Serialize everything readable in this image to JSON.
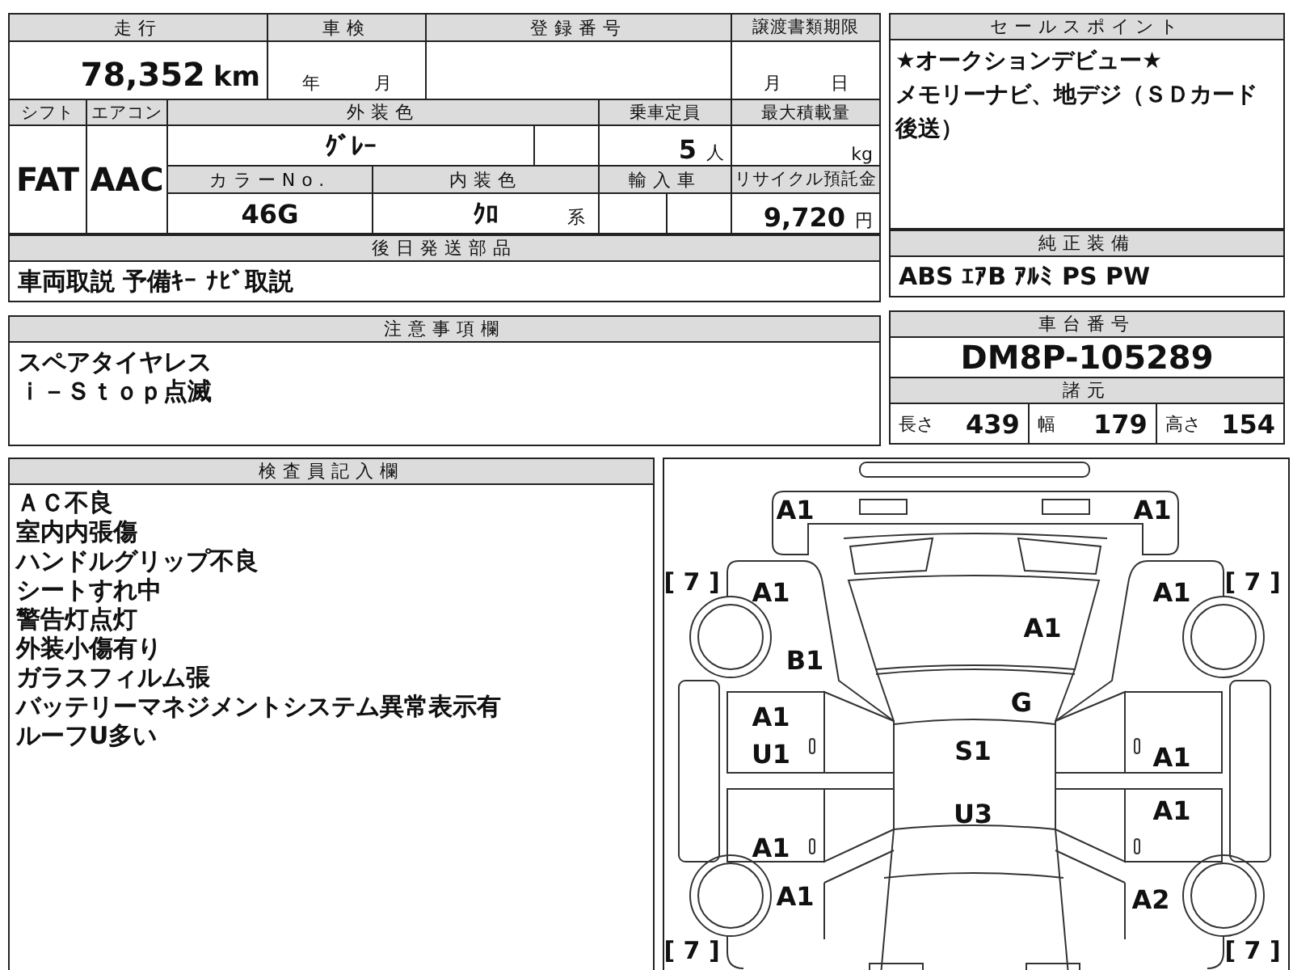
{
  "vehicle_table": {
    "mileage": {
      "label": "走行",
      "value": "78,352",
      "unit": "km"
    },
    "inspection": {
      "label": "車検",
      "year_unit": "年",
      "month_unit": "月"
    },
    "registration_number": {
      "label": "登録番号"
    },
    "document_deadline": {
      "label": "譲渡書類期限",
      "month_unit": "月",
      "day_unit": "日"
    },
    "shift": {
      "label": "シフト",
      "value": "FAT"
    },
    "aircon": {
      "label": "エアコン",
      "value": "AAC"
    },
    "exterior_color": {
      "label": "外装色",
      "value": "ｸﾞﾚｰ"
    },
    "capacity": {
      "label": "乗車定員",
      "value": "5",
      "unit": "人"
    },
    "max_load": {
      "label": "最大積載量",
      "unit": "kg"
    },
    "color_no": {
      "label": "カラーNo.",
      "value": "46G"
    },
    "interior_color": {
      "label": "内装色",
      "value": "ｸﾛ",
      "suffix": "系"
    },
    "import_car": {
      "label": "輸入車"
    },
    "recycle_fee": {
      "label": "リサイクル預託金",
      "value": "9,720",
      "unit": "円"
    }
  },
  "later_parts": {
    "label": "後日発送部品",
    "value": "車両取説 予備ｷｰ ﾅﾋﾞ取説"
  },
  "caution": {
    "label": "注意事項欄",
    "lines": [
      "スペアタイヤレス",
      "ｉ－Ｓｔｏｐ点滅"
    ]
  },
  "sales_points": {
    "label": "セールスポイント",
    "lines": [
      "★オークションデビュー★",
      "メモリーナビ、地デジ（ＳＤカード後送）"
    ]
  },
  "standard_equipment": {
    "label": "純正装備",
    "value": "ABS ｴｱB ｱﾙﾐ PS PW"
  },
  "chassis_number": {
    "label": "車台番号",
    "value": "DM8P-105289"
  },
  "specs": {
    "label": "諸元",
    "items": [
      {
        "label": "長さ",
        "value": "439"
      },
      {
        "label": "幅",
        "value": "179"
      },
      {
        "label": "高さ",
        "value": "154"
      }
    ]
  },
  "inspector_notes": {
    "label": "検査員記入欄",
    "lines": [
      "ＡＣ不良",
      "室内内張傷",
      "ハンドルグリップ不良",
      "シートすれ中",
      "警告灯点灯",
      "外装小傷有り",
      "ガラスフィルム張",
      "バッテリーマネジメントシステム異常表示有",
      "ルーフU多い"
    ]
  },
  "condition_diagram": {
    "damage_marks": [
      "A1",
      "A1",
      "A1",
      "A1",
      "A1",
      "B1",
      "G",
      "A1",
      "U1",
      "S1",
      "A1",
      "A1",
      "U3",
      "A1",
      "A1",
      "A2"
    ],
    "tire_marks": [
      "[ 7 ]",
      "[ 7 ]",
      "[ 7 ]",
      "[ 7 ]"
    ]
  }
}
